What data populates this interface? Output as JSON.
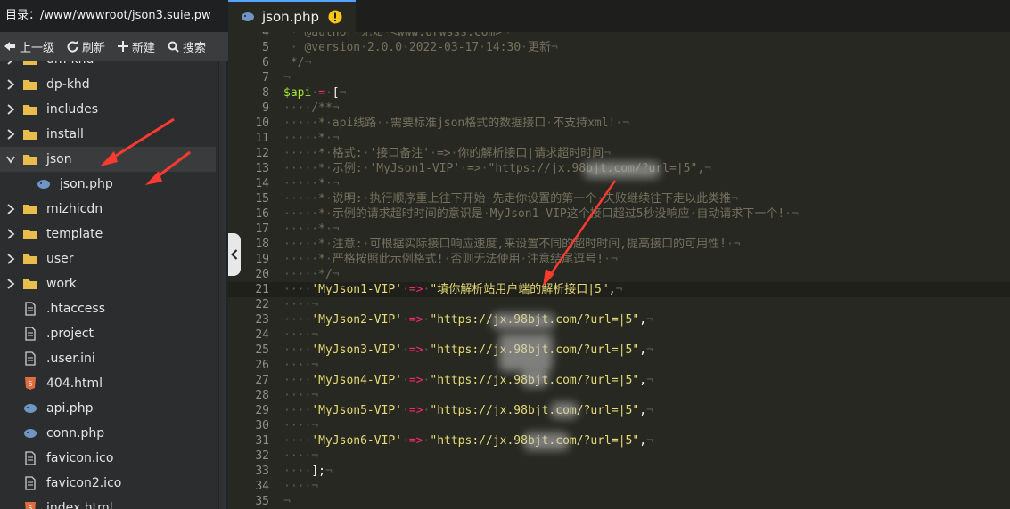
{
  "sidebar": {
    "directory_label": "目录：/www/wwwroot/json3.suie.pw",
    "toolbar": {
      "up": "上一级",
      "refresh": "刷新",
      "new": "新建",
      "search": "搜索"
    },
    "tree": [
      {
        "label": "dm-khd",
        "type": "folder",
        "expanded": false
      },
      {
        "label": "dp-khd",
        "type": "folder",
        "expanded": false
      },
      {
        "label": "includes",
        "type": "folder",
        "expanded": false
      },
      {
        "label": "install",
        "type": "folder",
        "expanded": false
      },
      {
        "label": "json",
        "type": "folder",
        "expanded": true
      },
      {
        "label": "json.php",
        "type": "php",
        "expanded": false
      },
      {
        "label": "mizhicdn",
        "type": "folder",
        "expanded": false
      },
      {
        "label": "template",
        "type": "folder",
        "expanded": false
      },
      {
        "label": "user",
        "type": "folder",
        "expanded": false
      },
      {
        "label": "work",
        "type": "folder",
        "expanded": false
      },
      {
        "label": ".htaccess",
        "type": "file",
        "expanded": false
      },
      {
        "label": ".project",
        "type": "file",
        "expanded": false
      },
      {
        "label": ".user.ini",
        "type": "file",
        "expanded": false
      },
      {
        "label": "404.html",
        "type": "html",
        "expanded": false
      },
      {
        "label": "api.php",
        "type": "php",
        "expanded": false
      },
      {
        "label": "conn.php",
        "type": "php",
        "expanded": false
      },
      {
        "label": "favicon.ico",
        "type": "file",
        "expanded": false
      },
      {
        "label": "favicon2.ico",
        "type": "file",
        "expanded": false
      },
      {
        "label": "index.html",
        "type": "html",
        "expanded": false
      }
    ]
  },
  "editor": {
    "tab_label": "json.php",
    "tab_modified_icon": "warning-icon",
    "colors": {
      "background": "#272822",
      "comment": "#75715e",
      "string": "#e6db74",
      "operator": "#f92672",
      "variable": "#a6e22e",
      "line_number": "#8f908a"
    },
    "current_line": 21,
    "lines": [
      {
        "n": "4",
        "text": " · @author·无知·<www.urwsss.com>¬"
      },
      {
        "n": "5",
        "text": " · @version·2.0.0·2022-03-17·14:30·更新¬"
      },
      {
        "n": "6",
        "text": " */¬"
      },
      {
        "n": "7",
        "text": "¬"
      },
      {
        "n": "8",
        "text": "$api·=·[¬"
      },
      {
        "n": "9",
        "text": "····/**¬"
      },
      {
        "n": "10",
        "text": "·····*·api线路··需要标准json格式的数据接口·不支持xml!·¬"
      },
      {
        "n": "11",
        "text": "·····*·¬"
      },
      {
        "n": "12",
        "text": "·····*·格式:·'接口备注'·=>·你的解析接口|请求超时时间¬"
      },
      {
        "n": "13",
        "text": "·····*·示例:·'MyJson1-VIP'·=>·\"https://jx.98bjt.com/?url=|5\",¬"
      },
      {
        "n": "14",
        "text": "·····*·¬"
      },
      {
        "n": "15",
        "text": "·····*·说明:·执行顺序重上往下开始·先走你设置的第一个·失败继续往下走以此类推¬"
      },
      {
        "n": "16",
        "text": "·····*·示例的请求超时时间的意识是·MyJson1-VIP这个接口超过5秒没响应·自动请求下一个!·¬"
      },
      {
        "n": "17",
        "text": "·····*·¬"
      },
      {
        "n": "18",
        "text": "·····*·注意:·可根据实际接口响应速度,来设置不同的超时时间,提高接口的可用性!·¬"
      },
      {
        "n": "19",
        "text": "·····*·严格按照此示例格式!·否则无法使用·注意结尾逗号!·¬"
      },
      {
        "n": "20",
        "text": "·····*/¬"
      },
      {
        "n": "21",
        "text": "····'MyJson1-VIP'·=>·\"填你解析站用户端的解析接口|5\",¬"
      },
      {
        "n": "22",
        "text": "····¬"
      },
      {
        "n": "23",
        "text": "····'MyJson2-VIP'·=>·\"https://jx.98bjt.com/?url=|5\",¬"
      },
      {
        "n": "24",
        "text": "····¬"
      },
      {
        "n": "25",
        "text": "····'MyJson3-VIP'·=>·\"https://jx.98bjt.com/?url=|5\",¬"
      },
      {
        "n": "26",
        "text": "····¬"
      },
      {
        "n": "27",
        "text": "····'MyJson4-VIP'·=>·\"https://jx.98bjt.com/?url=|5\",¬"
      },
      {
        "n": "28",
        "text": "····¬"
      },
      {
        "n": "29",
        "text": "····'MyJson5-VIP'·=>·\"https://jx.98bjt.com/?url=|5\",¬"
      },
      {
        "n": "30",
        "text": "····¬"
      },
      {
        "n": "31",
        "text": "····'MyJson6-VIP'·=>·\"https://jx.98bjt.com/?url=|5\",¬"
      },
      {
        "n": "32",
        "text": "····¬"
      },
      {
        "n": "33",
        "text": "····];¬"
      },
      {
        "n": "34",
        "text": "····¬"
      },
      {
        "n": "35",
        "text": "¬"
      }
    ]
  },
  "annotation_color": "#ff3b30"
}
